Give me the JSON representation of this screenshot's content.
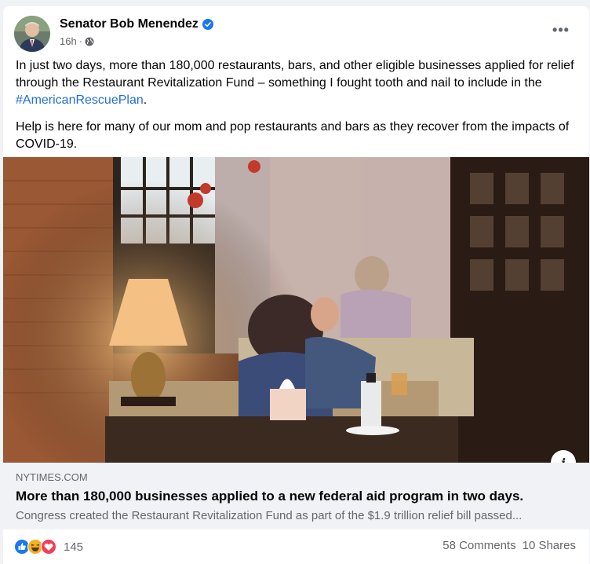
{
  "post": {
    "author": "Senator Bob Menendez",
    "time": "16h",
    "dot": "·",
    "more_label": "•••",
    "paragraph1_text": "In just two days, more than 180,000 restaurants, bars, and other eligible businesses applied for relief through the Restaurant Revitalization Fund – something I fought tooth and nail to include in the ",
    "hashtag": "#AmericanRescuePlan",
    "paragraph1_end": ".",
    "paragraph2": "Help is here for many of our mom and pop restaurants and bars as they recover from the impacts of COVID-19."
  },
  "link": {
    "domain": "NYTIMES.COM",
    "title": "More than 180,000 businesses applied to a new federal aid program in two days.",
    "description": "Congress created the Restaurant Revitalization Fund as part of the $1.9 trillion relief bill passed...",
    "info_label": "i"
  },
  "footer": {
    "reaction_count": "145",
    "comments": "58 Comments",
    "shares": "10 Shares"
  },
  "icons": [
    "verified-badge-icon",
    "globe-icon",
    "more-options-icon",
    "like-reaction-icon",
    "haha-reaction-icon",
    "love-reaction-icon",
    "info-icon"
  ],
  "colors": {
    "hashtag": "#216fdb",
    "verified": "#1877f2",
    "like": "#1877f2",
    "love": "#f33e58",
    "haha": "#f7b125"
  }
}
